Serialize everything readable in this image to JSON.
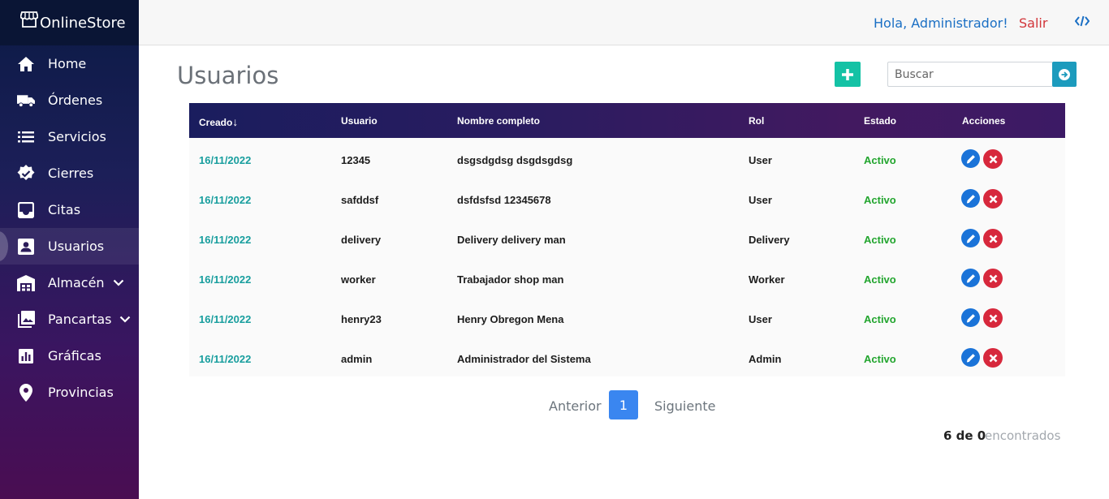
{
  "app": {
    "brand": "OnlineStore"
  },
  "sidebar": {
    "items": [
      {
        "label": "Home",
        "icon": "home-icon"
      },
      {
        "label": "Órdenes",
        "icon": "truck-icon"
      },
      {
        "label": "Servicios",
        "icon": "list-icon"
      },
      {
        "label": "Cierres",
        "icon": "badge-check-icon"
      },
      {
        "label": "Citas",
        "icon": "inbox-icon"
      },
      {
        "label": "Usuarios",
        "icon": "user-card-icon",
        "active": true
      },
      {
        "label": "Almacén",
        "icon": "warehouse-icon",
        "expandable": true
      },
      {
        "label": "Pancartas",
        "icon": "images-icon",
        "expandable": true
      },
      {
        "label": "Gráficas",
        "icon": "chart-icon"
      },
      {
        "label": "Provincias",
        "icon": "map-pin-icon"
      }
    ]
  },
  "header": {
    "greeting": "Hola, Administrador!",
    "logout": "Salir"
  },
  "main": {
    "title": "Usuarios",
    "search": {
      "placeholder": "Buscar",
      "value": ""
    }
  },
  "table": {
    "columns": [
      "Creado",
      "Usuario",
      "Nombre completo",
      "Rol",
      "Estado",
      "Acciones"
    ],
    "sort_indicator": "↓",
    "rows": [
      {
        "created": "16/11/2022",
        "user": "12345",
        "name": "dsgsdgdsg dsgdsgdsg",
        "role": "User",
        "status": "Activo"
      },
      {
        "created": "16/11/2022",
        "user": "safddsf",
        "name": "dsfdsfsd 12345678",
        "role": "User",
        "status": "Activo"
      },
      {
        "created": "16/11/2022",
        "user": "delivery",
        "name": "Delivery delivery man",
        "role": "Delivery",
        "status": "Activo"
      },
      {
        "created": "16/11/2022",
        "user": "worker",
        "name": "Trabajador shop man",
        "role": "Worker",
        "status": "Activo"
      },
      {
        "created": "16/11/2022",
        "user": "henry23",
        "name": "Henry Obregon Mena",
        "role": "User",
        "status": "Activo"
      },
      {
        "created": "16/11/2022",
        "user": "admin",
        "name": "Administrador del Sistema",
        "role": "Admin",
        "status": "Activo"
      }
    ]
  },
  "pagination": {
    "prev": "Anterior",
    "current": "1",
    "next": "Siguiente",
    "count": "6 de 0",
    "found": "encontrados"
  },
  "colors": {
    "accent_teal": "#14c2a5",
    "date_teal": "#189e9e",
    "status_green": "#22a52e",
    "edit_blue": "#1a73d8",
    "delete_red": "#d7283c",
    "page_blue": "#3a86f0",
    "logout_red": "#d2353a",
    "greeting_blue": "#1a6fc4"
  }
}
